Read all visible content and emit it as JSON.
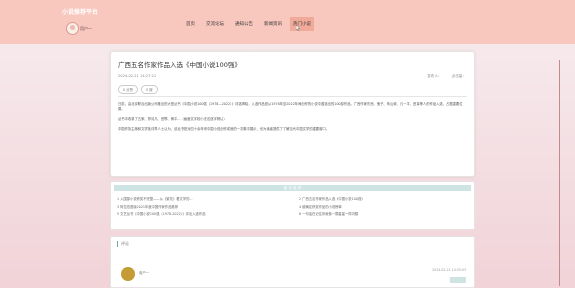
{
  "header": {
    "brand": "小说推荐平台",
    "username": "用户一",
    "nav": [
      "首页",
      "交流论坛",
      "通知公告",
      "新闻资讯",
      "热门小说"
    ]
  },
  "article": {
    "title": "广西五名作家作品入选《中国小说100强》",
    "date": "2024-02-21 14:27:21",
    "author_label": "发布人：",
    "views_label": "点击量：",
    "like_label": "0 点赞",
    "dislike_label": "0 踩",
    "paragraphs": [
      "日前，由北京联合出版公司推出的大型丛书《中国小说100强（1978—2022）》评选揭晓，入选作品是从1978年至2022年间创作的小说中遴选出的100部作品。广西作家东西、鬼子、朱山坡、凡一平、田耳等人的作品入选，占据重要位置。",
      "丛书中收录了五家、郑清凡、田鄂、黄平...（画面文字较小无法逐字辨认）",
      "中国作协主席和文学批评界人士认为，该丛书是对四十余年来中国小说创作成就的一次集中展示，也为读者提供了了解当代中国文学的重要窗口。"
    ]
  },
  "related": {
    "heading": "相 关 推 荐",
    "left": [
      "1 入围部小说获奖不完整——从《繁花》看文学的...",
      "3 阿拉伯语版2021年度中国作家作品推荐",
      "5 文艺丛书《中国小说100强（1978-2022）》评出入选作品"
    ],
    "right": [
      "2 广西五名作家作品入选《中国小说100强》",
      "4 被确定获奖作品的小说榜单",
      "6 一句话在记住你就像一颗星星一样闪耀"
    ]
  },
  "comments": {
    "title": "评论",
    "user": "用户一",
    "time": "2024-02-21 14:35:03",
    "tag": ""
  },
  "colors": {
    "topbar": "#f8c7be",
    "active_nav": "#f0aa9a",
    "related_header": "#cde3e4"
  }
}
